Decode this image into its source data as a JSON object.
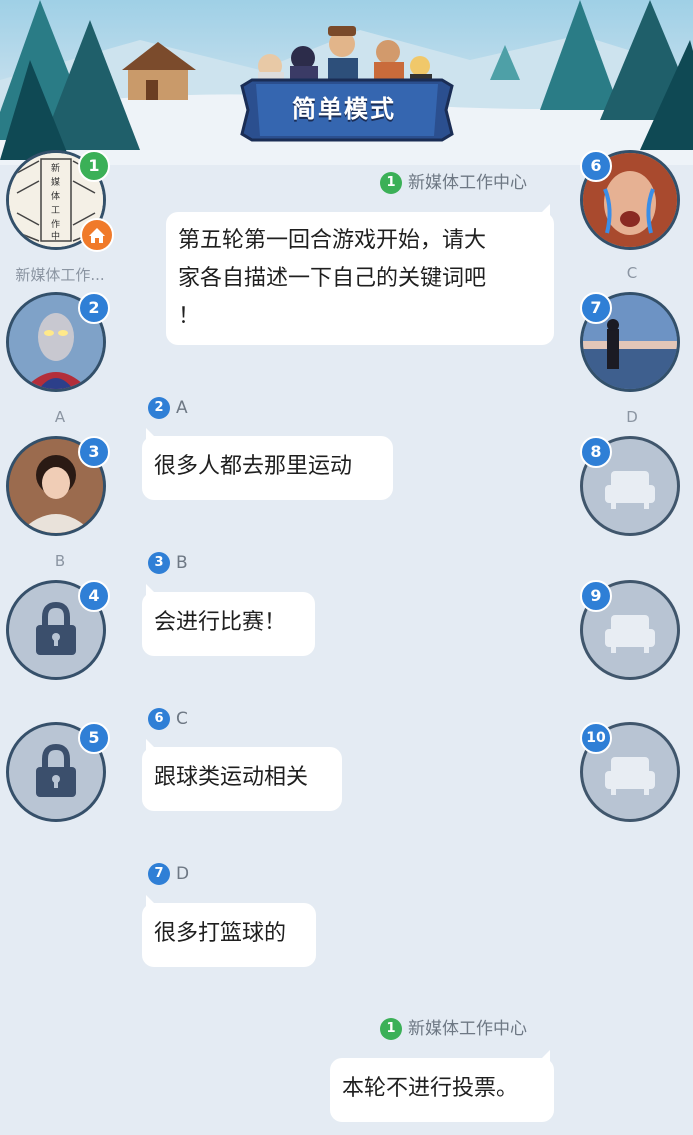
{
  "header": {
    "mode_title": "简单模式"
  },
  "seats": {
    "s1": {
      "number": "1",
      "name": "新媒体工作..."
    },
    "s2": {
      "number": "2",
      "name": "A"
    },
    "s3": {
      "number": "3",
      "name": "B"
    },
    "s4": {
      "number": "4"
    },
    "s5": {
      "number": "5"
    },
    "s6": {
      "number": "6",
      "name": "C"
    },
    "s7": {
      "number": "7",
      "name": "D"
    },
    "s8": {
      "number": "8"
    },
    "s9": {
      "number": "9"
    },
    "s10": {
      "number": "10"
    }
  },
  "messages": [
    {
      "num": "1",
      "speaker": "新媒体工作中心",
      "text_line1": "第五轮第一回合游戏开始，请大",
      "text_line2": "家各自描述一下自己的关键词吧",
      "text_line3": "！"
    },
    {
      "num": "2",
      "speaker": "A",
      "text": "很多人都去那里运动"
    },
    {
      "num": "3",
      "speaker": "B",
      "text": "会进行比赛！"
    },
    {
      "num": "6",
      "speaker": "C",
      "text": "跟球类运动相关"
    },
    {
      "num": "7",
      "speaker": "D",
      "text": "很多打篮球的"
    },
    {
      "num": "1",
      "speaker": "新媒体工作中心",
      "text": "本轮不进行投票。"
    }
  ],
  "colors": {
    "accent_blue": "#2f7fd6",
    "host_green": "#3bb057",
    "background": "#e4ebf3"
  }
}
